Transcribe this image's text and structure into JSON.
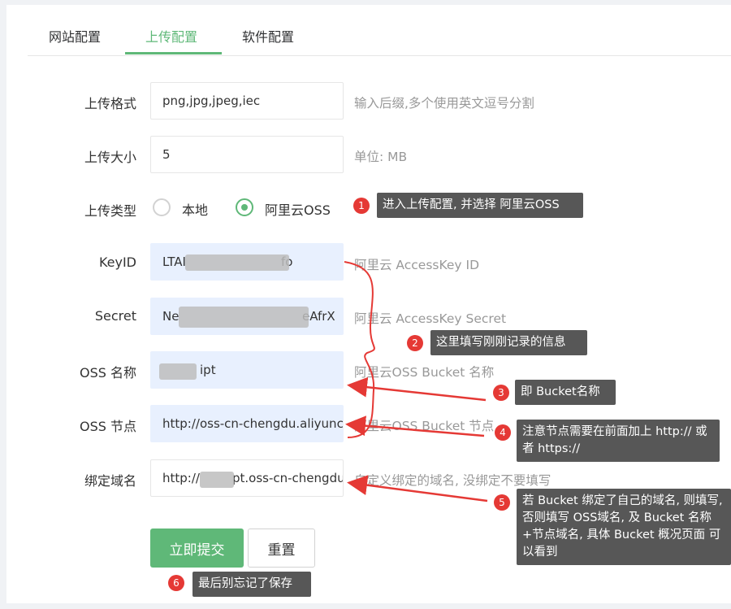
{
  "tabs": [
    {
      "label": "网站配置",
      "active": false
    },
    {
      "label": "上传配置",
      "active": true
    },
    {
      "label": "软件配置",
      "active": false
    }
  ],
  "form": {
    "upload_format": {
      "label": "上传格式",
      "value": "png,jpg,jpeg,iec",
      "hint": "输入后缀,多个使用英文逗号分割"
    },
    "upload_size": {
      "label": "上传大小",
      "value": "5",
      "hint": "单位: MB"
    },
    "upload_type": {
      "label": "上传类型",
      "options": [
        "本地",
        "阿里云OSS"
      ],
      "selected": "阿里云OSS"
    },
    "key_id": {
      "label": "KeyID",
      "value": "LTAI",
      "value_tail": "fo",
      "hint": "阿里云 AccessKey ID"
    },
    "secret": {
      "label": "Secret",
      "value": "Ne",
      "value_tail": "eAfrX",
      "hint": "阿里云 AccessKey Secret"
    },
    "oss_name": {
      "label": "OSS 名称",
      "value": "ipt",
      "hint": "阿里云OSS Bucket 名称"
    },
    "oss_node": {
      "label": "OSS 节点",
      "value": "http://oss-cn-chengdu.aliyuncs.com",
      "hint": "阿里云OSS Bucket 节点"
    },
    "bind_domain": {
      "label": "绑定域名",
      "value_head": "http://",
      "value": "pt.oss-cn-chengdu.aliyuncs.com",
      "hint": "自定义绑定的域名, 没绑定不要填写"
    },
    "submit_label": "立即提交",
    "reset_label": "重置"
  },
  "annotations": [
    {
      "num": "1",
      "text": "进入上传配置, 并选择 阿里云OSS"
    },
    {
      "num": "2",
      "text": "这里填写刚刚记录的信息"
    },
    {
      "num": "3",
      "text": "即 Bucket名称"
    },
    {
      "num": "4",
      "text": "注意节点需要在前面加上 http:// 或者 https://"
    },
    {
      "num": "5",
      "text": "若 Bucket 绑定了自己的域名, 则填写, 否则填写 OSS域名, 及 Bucket 名称+节点域名, 具体 Bucket 概况页面 可以看到"
    },
    {
      "num": "6",
      "text": "最后别忘记了保存"
    }
  ],
  "colors": {
    "accent": "#5fb878",
    "annotation_red": "#e53935",
    "annotation_box": "#575757",
    "autofill": "#e8f0fe"
  }
}
